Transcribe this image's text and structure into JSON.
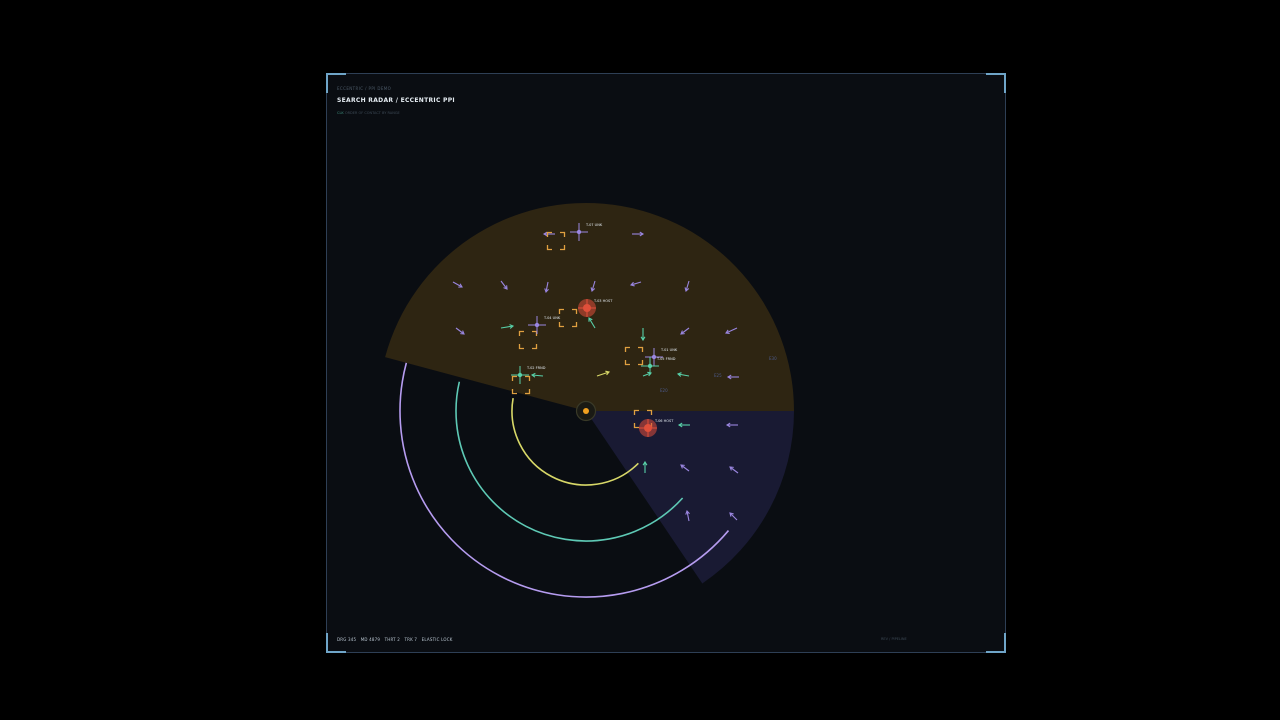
{
  "header": {
    "label": "ECCENTRIC / PPI DEMO",
    "title": "SEARCH RADAR  /  ECCENTRIC PPI",
    "sub_accent": "CLK",
    "sub_text": "ORDER OF CONTACT BY RANGE"
  },
  "footer": {
    "status": [
      "DRG 345",
      "MD 4879",
      "THRT 2",
      "TRK 7",
      "ELASTIC LOCK"
    ],
    "right": "REV / PIPELINE"
  },
  "sectors": {
    "label_a": "E30",
    "label_b": "E25",
    "label_c": "E20"
  },
  "colors": {
    "ring_inner": "#d8d868",
    "ring_mid": "#5ec9b5",
    "ring_outer": "#b69cf0",
    "arrow_violet": "#9a86e0",
    "arrow_teal": "#58d0a8",
    "arrow_yellow": "#d8d868",
    "hostile": "#e04f3a",
    "bracket": "#e0a040",
    "sector_warm": "#2e2512",
    "sector_cool": "#191a33"
  },
  "targets": [
    {
      "label": "T-07 UNK",
      "kind": "unk"
    },
    {
      "label": "T-03 HOST",
      "kind": "host"
    },
    {
      "label": "T-04 UNK",
      "kind": "unk"
    },
    {
      "label": "T-01 UNK",
      "kind": "unk"
    },
    {
      "label": "T-02 FRND",
      "kind": "frnd"
    },
    {
      "label": "T-05 FRND",
      "kind": "frnd"
    },
    {
      "label": "T-06 HOST",
      "kind": "host"
    }
  ]
}
